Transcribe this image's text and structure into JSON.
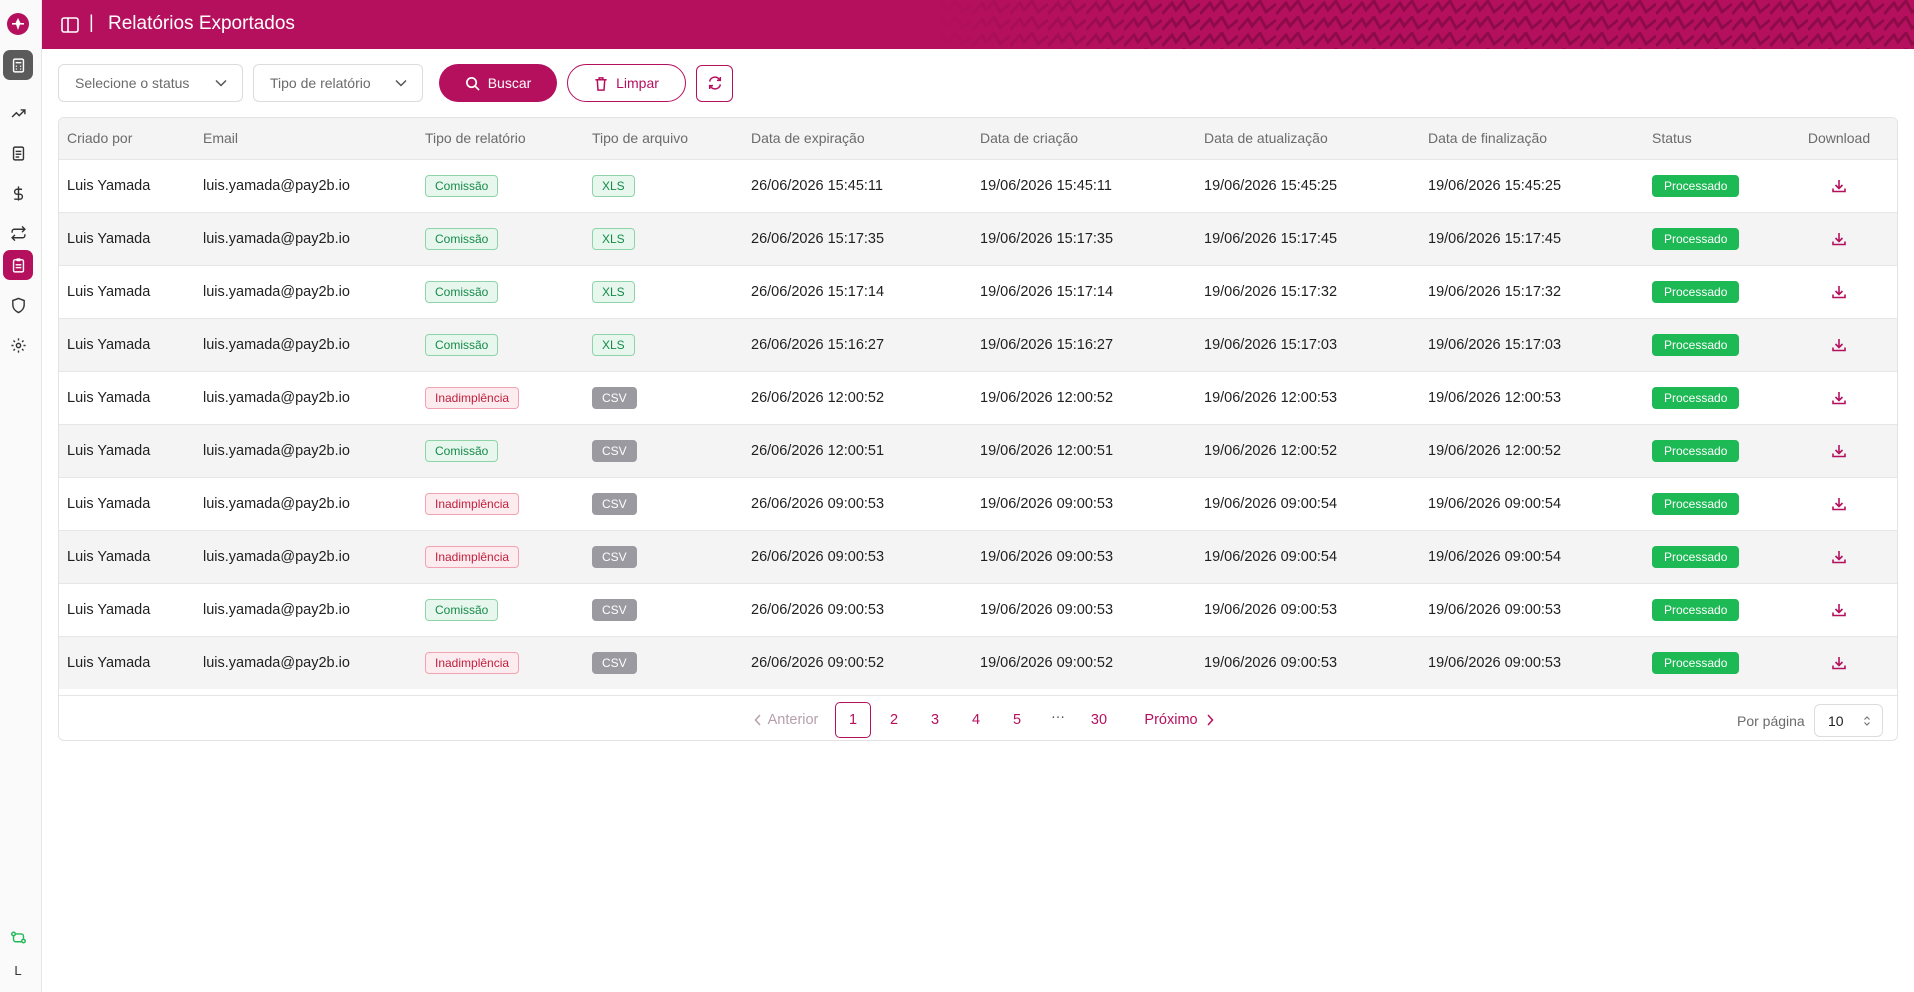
{
  "header": {
    "title": "Relatórios Exportados",
    "separator": "|"
  },
  "sidebar": {
    "items": [
      {
        "icon": "calculator-icon",
        "active": false
      },
      {
        "icon": "trend-up-icon",
        "active": false
      },
      {
        "icon": "document-icon",
        "active": false
      },
      {
        "icon": "dollar-icon",
        "active": false
      },
      {
        "icon": "transfer-icon",
        "active": false
      },
      {
        "icon": "clipboard-icon",
        "active": true
      },
      {
        "icon": "shield-icon",
        "active": false
      },
      {
        "icon": "gear-icon",
        "active": false
      }
    ],
    "footer_initial": "L"
  },
  "filters": {
    "status_placeholder": "Selecione o status",
    "type_placeholder": "Tipo de relatório",
    "search_label": "Buscar",
    "clear_label": "Limpar"
  },
  "table": {
    "columns": [
      "Criado por",
      "Email",
      "Tipo de relatório",
      "Tipo de arquivo",
      "Data de expiração",
      "Data de criação",
      "Data de atualização",
      "Data de finalização",
      "Status",
      "Download"
    ],
    "rows": [
      {
        "created_by": "Luis Yamada",
        "email": "luis.yamada@pay2b.io",
        "report_type": "Comissão",
        "file_type": "XLS",
        "expiration": "26/06/2026 15:45:11",
        "created": "19/06/2026 15:45:11",
        "updated": "19/06/2026 15:45:25",
        "finished": "19/06/2026 15:45:25",
        "status": "Processado"
      },
      {
        "created_by": "Luis Yamada",
        "email": "luis.yamada@pay2b.io",
        "report_type": "Comissão",
        "file_type": "XLS",
        "expiration": "26/06/2026 15:17:35",
        "created": "19/06/2026 15:17:35",
        "updated": "19/06/2026 15:17:45",
        "finished": "19/06/2026 15:17:45",
        "status": "Processado"
      },
      {
        "created_by": "Luis Yamada",
        "email": "luis.yamada@pay2b.io",
        "report_type": "Comissão",
        "file_type": "XLS",
        "expiration": "26/06/2026 15:17:14",
        "created": "19/06/2026 15:17:14",
        "updated": "19/06/2026 15:17:32",
        "finished": "19/06/2026 15:17:32",
        "status": "Processado"
      },
      {
        "created_by": "Luis Yamada",
        "email": "luis.yamada@pay2b.io",
        "report_type": "Comissão",
        "file_type": "XLS",
        "expiration": "26/06/2026 15:16:27",
        "created": "19/06/2026 15:16:27",
        "updated": "19/06/2026 15:17:03",
        "finished": "19/06/2026 15:17:03",
        "status": "Processado"
      },
      {
        "created_by": "Luis Yamada",
        "email": "luis.yamada@pay2b.io",
        "report_type": "Inadimplência",
        "file_type": "CSV",
        "expiration": "26/06/2026 12:00:52",
        "created": "19/06/2026 12:00:52",
        "updated": "19/06/2026 12:00:53",
        "finished": "19/06/2026 12:00:53",
        "status": "Processado"
      },
      {
        "created_by": "Luis Yamada",
        "email": "luis.yamada@pay2b.io",
        "report_type": "Comissão",
        "file_type": "CSV",
        "expiration": "26/06/2026 12:00:51",
        "created": "19/06/2026 12:00:51",
        "updated": "19/06/2026 12:00:52",
        "finished": "19/06/2026 12:00:52",
        "status": "Processado"
      },
      {
        "created_by": "Luis Yamada",
        "email": "luis.yamada@pay2b.io",
        "report_type": "Inadimplência",
        "file_type": "CSV",
        "expiration": "26/06/2026 09:00:53",
        "created": "19/06/2026 09:00:53",
        "updated": "19/06/2026 09:00:54",
        "finished": "19/06/2026 09:00:54",
        "status": "Processado"
      },
      {
        "created_by": "Luis Yamada",
        "email": "luis.yamada@pay2b.io",
        "report_type": "Inadimplência",
        "file_type": "CSV",
        "expiration": "26/06/2026 09:00:53",
        "created": "19/06/2026 09:00:53",
        "updated": "19/06/2026 09:00:54",
        "finished": "19/06/2026 09:00:54",
        "status": "Processado"
      },
      {
        "created_by": "Luis Yamada",
        "email": "luis.yamada@pay2b.io",
        "report_type": "Comissão",
        "file_type": "CSV",
        "expiration": "26/06/2026 09:00:53",
        "created": "19/06/2026 09:00:53",
        "updated": "19/06/2026 09:00:53",
        "finished": "19/06/2026 09:00:53",
        "status": "Processado"
      },
      {
        "created_by": "Luis Yamada",
        "email": "luis.yamada@pay2b.io",
        "report_type": "Inadimplência",
        "file_type": "CSV",
        "expiration": "26/06/2026 09:00:52",
        "created": "19/06/2026 09:00:52",
        "updated": "19/06/2026 09:00:53",
        "finished": "19/06/2026 09:00:53",
        "status": "Processado"
      }
    ]
  },
  "pagination": {
    "prev_label": "Anterior",
    "next_label": "Próximo",
    "pages": [
      "1",
      "2",
      "3",
      "4",
      "5",
      "…",
      "30"
    ],
    "current": "1",
    "per_page_label": "Por página",
    "per_page_value": "10"
  },
  "colors": {
    "brand": "#b5105e",
    "success": "#1db954",
    "danger": "#c0203e"
  }
}
